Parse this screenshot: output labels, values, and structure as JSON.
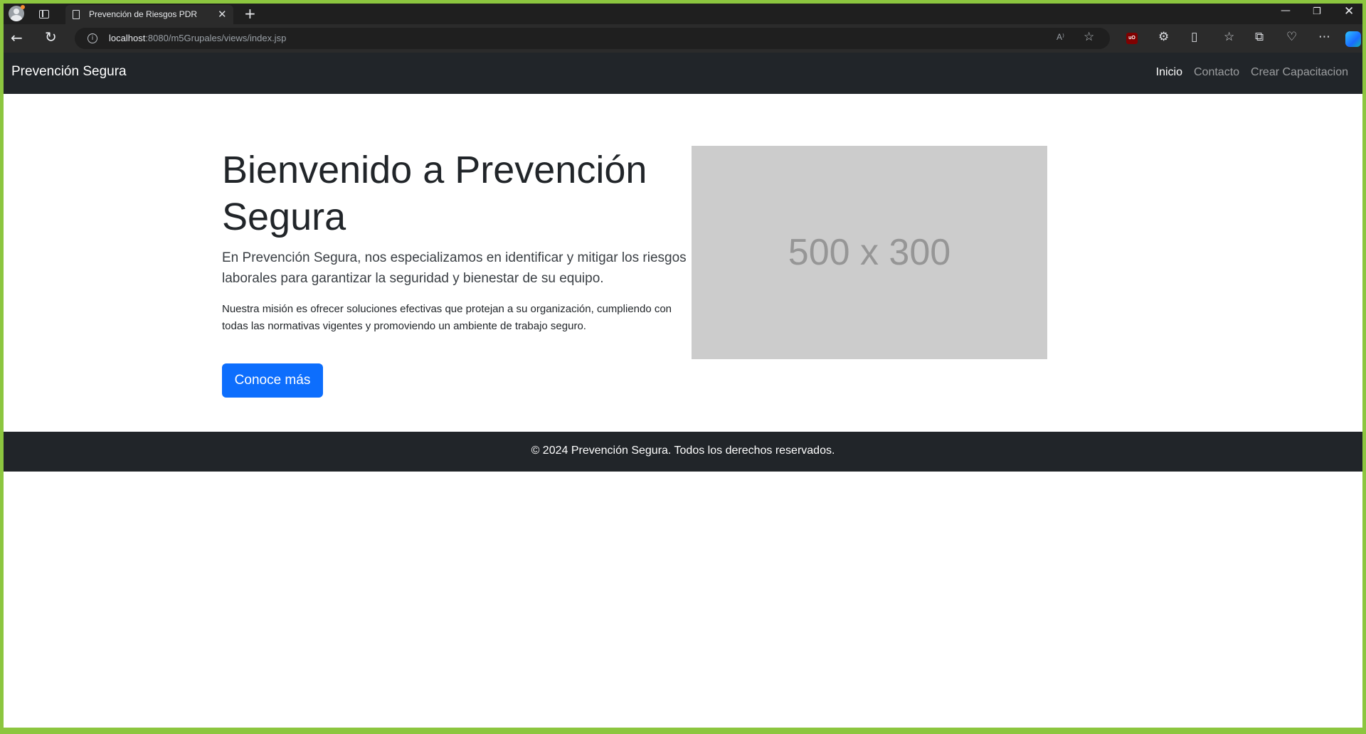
{
  "browser": {
    "tab_title": "Prevención de Riesgos PDR",
    "new_tab_symbol": "+",
    "url_host": "localhost",
    "url_path": ":8080/m5Grupales/views/index.jsp",
    "read_aloud_label": "A⁾",
    "icons": [
      "profile-icon",
      "tab-actions-icon",
      "page-icon",
      "close-icon",
      "back-icon",
      "reload-icon",
      "info-icon",
      "read-aloud-icon",
      "star-icon",
      "ublock-icon",
      "extensions-icon",
      "split-screen-icon",
      "favorites-icon",
      "collections-icon",
      "browser-essentials-icon",
      "more-icon",
      "copilot-icon"
    ]
  },
  "navbar": {
    "brand": "Prevención Segura",
    "links": [
      {
        "label": "Inicio",
        "active": true
      },
      {
        "label": "Contacto",
        "active": false
      },
      {
        "label": "Crear Capacitacion",
        "active": false
      }
    ]
  },
  "hero": {
    "title": "Bienvenido a Prevención Segura",
    "lead": "En Prevención Segura, nos especializamos en identificar y mitigar los riesgos laborales para garantizar la seguridad y bienestar de su equipo.",
    "mission": "Nuestra misión es ofrecer soluciones efectivas que protejan a su organización, cumpliendo con todas las normativas vigentes y promoviendo un ambiente de trabajo seguro.",
    "cta_label": "Conoce más",
    "image_placeholder_text": "500 x 300"
  },
  "footer": {
    "text": "© 2024 Prevención Segura. Todos los derechos reservados."
  },
  "colors": {
    "navbar_bg": "#212529",
    "primary": "#0d6efd",
    "placeholder_bg": "#cccccc",
    "window_border": "#8cc63f"
  }
}
